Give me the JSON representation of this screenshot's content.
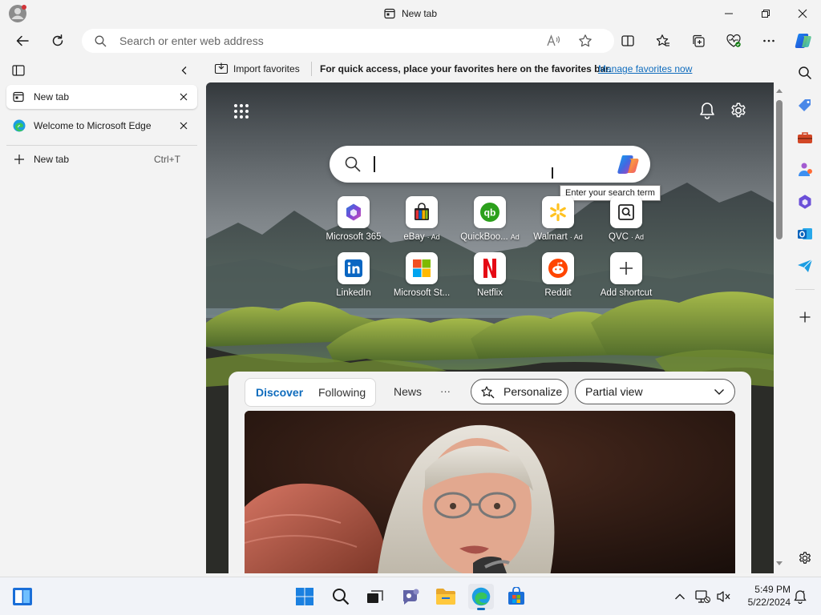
{
  "window": {
    "title": "New tab"
  },
  "toolbar": {
    "address_placeholder": "Search or enter web address"
  },
  "vertical_tabs": {
    "tabs": [
      {
        "label": "New tab"
      },
      {
        "label": "Welcome to Microsoft Edge"
      }
    ],
    "new_tab_label": "New tab",
    "new_tab_shortcut": "Ctrl+T"
  },
  "favorites_bar": {
    "import_label": "Import favorites",
    "message": "For quick access, place your favorites here on the favorites bar.",
    "manage_link": "Manage favorites now"
  },
  "new_tab_page": {
    "search_tooltip": "Enter your search term",
    "shortcuts": [
      {
        "label": "Microsoft 365",
        "ad": ""
      },
      {
        "label": "eBay",
        "ad": "· Ad"
      },
      {
        "label": "QuickBoo...",
        "ad": "Ad"
      },
      {
        "label": "Walmart",
        "ad": "· Ad"
      },
      {
        "label": "QVC",
        "ad": "· Ad"
      },
      {
        "label": "LinkedIn",
        "ad": ""
      },
      {
        "label": "Microsoft St...",
        "ad": ""
      },
      {
        "label": "Netflix",
        "ad": ""
      },
      {
        "label": "Reddit",
        "ad": ""
      },
      {
        "label": "Add shortcut",
        "ad": ""
      }
    ]
  },
  "feed": {
    "tabs": [
      "Discover",
      "Following"
    ],
    "news_label": "News",
    "more_label": "···",
    "personalize_label": "Personalize",
    "view_select": "Partial view"
  },
  "taskbar": {
    "time": "5:49 PM",
    "date": "5/22/2024"
  },
  "colors": {
    "accent": "#0f6cbd",
    "link": "#0f6cbd"
  }
}
